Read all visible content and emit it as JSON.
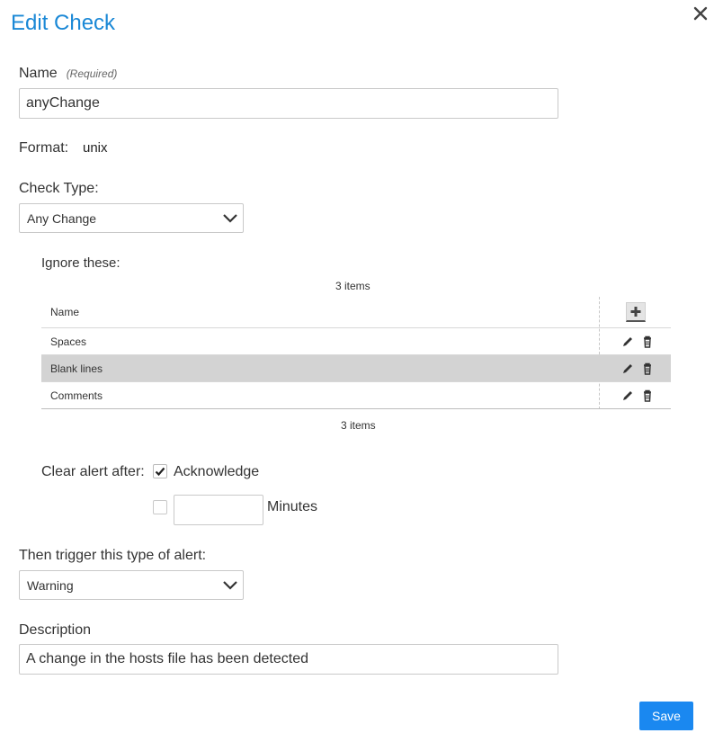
{
  "dialog": {
    "title": "Edit Check",
    "close_icon": "close-icon"
  },
  "name_field": {
    "label": "Name",
    "required_hint": "(Required)",
    "value": "anyChange"
  },
  "format": {
    "label": "Format:",
    "value": "unix"
  },
  "check_type": {
    "label": "Check Type:",
    "selected": "Any Change"
  },
  "ignore": {
    "label": "Ignore these:",
    "count_top": "3 items",
    "count_bottom": "3 items",
    "column_header": "Name",
    "rows": [
      {
        "name": "Spaces",
        "selected": false
      },
      {
        "name": "Blank lines",
        "selected": true
      },
      {
        "name": "Comments",
        "selected": false
      }
    ],
    "icons": {
      "add": "plus-icon",
      "edit": "pencil-icon",
      "delete": "trash-icon"
    }
  },
  "clear_alert": {
    "label": "Clear alert after:",
    "acknowledge_label": "Acknowledge",
    "acknowledge_checked": true,
    "minutes_label": "Minutes",
    "minutes_checked": false,
    "minutes_value": ""
  },
  "alert_type": {
    "label": "Then trigger this type of alert:",
    "selected": "Warning"
  },
  "description": {
    "label": "Description",
    "value": "A change in the hosts file has been detected"
  },
  "actions": {
    "save_label": "Save"
  },
  "colors": {
    "title": "#1a88d6",
    "save_button": "#1a88f0",
    "selected_row": "#d3d3d3"
  }
}
